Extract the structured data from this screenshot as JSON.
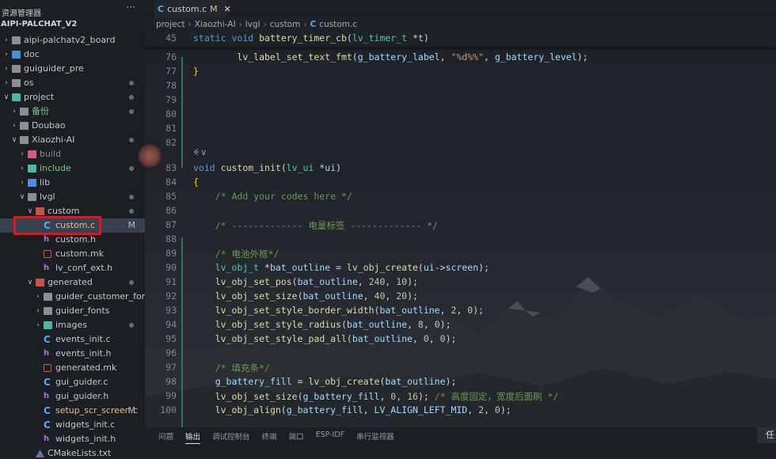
{
  "explorer": {
    "header": "资源管理器",
    "more": "···",
    "project": "AIPI-PALCHAT_V2",
    "items": [
      {
        "label": "aipi-palchatv2_board",
        "level": 0,
        "type": "folder",
        "color": "gray",
        "expanded": false,
        "dot": false
      },
      {
        "label": "doc",
        "level": 0,
        "type": "folder",
        "color": "blue",
        "expanded": false,
        "dot": false
      },
      {
        "label": "guiguider_pre",
        "level": 0,
        "type": "folder",
        "color": "gray",
        "expanded": false,
        "dot": false
      },
      {
        "label": "os",
        "level": 0,
        "type": "folder",
        "color": "gray",
        "expanded": false,
        "dot": true
      },
      {
        "label": "project",
        "level": 0,
        "type": "folder",
        "color": "teal",
        "expanded": true,
        "dot": true
      },
      {
        "label": "备份",
        "level": 1,
        "type": "folder",
        "color": "gray",
        "expanded": false,
        "dot": true,
        "green": true
      },
      {
        "label": "Doubao",
        "level": 1,
        "type": "folder",
        "color": "gray",
        "expanded": false,
        "dot": false
      },
      {
        "label": "Xiaozhi-AI",
        "level": 1,
        "type": "folder",
        "color": "gray",
        "expanded": true,
        "dot": true
      },
      {
        "label": "build",
        "level": 2,
        "type": "folder",
        "color": "pink",
        "expanded": false,
        "dot": false,
        "dim": true
      },
      {
        "label": "include",
        "level": 2,
        "type": "folder",
        "color": "teal",
        "expanded": false,
        "dot": true,
        "green": true
      },
      {
        "label": "lib",
        "level": 2,
        "type": "folder",
        "color": "blue",
        "expanded": false,
        "dot": false
      },
      {
        "label": "lvgl",
        "level": 2,
        "type": "folder",
        "color": "gray",
        "expanded": true,
        "dot": true
      },
      {
        "label": "custom",
        "level": 3,
        "type": "folder",
        "color": "red",
        "expanded": true,
        "dot": true
      },
      {
        "label": "custom.c",
        "level": 4,
        "type": "c",
        "selected": true,
        "mod": "M"
      },
      {
        "label": "custom.h",
        "level": 4,
        "type": "h"
      },
      {
        "label": "custom.mk",
        "level": 4,
        "type": "mk"
      },
      {
        "label": "lv_conf_ext.h",
        "level": 4,
        "type": "h"
      },
      {
        "label": "generated",
        "level": 3,
        "type": "folder",
        "color": "red",
        "expanded": true,
        "dot": true
      },
      {
        "label": "guider_customer_fonts",
        "level": 4,
        "type": "folder",
        "color": "gray",
        "expanded": false
      },
      {
        "label": "guider_fonts",
        "level": 4,
        "type": "folder",
        "color": "gray",
        "expanded": false
      },
      {
        "label": "images",
        "level": 4,
        "type": "folder",
        "color": "teal",
        "expanded": false,
        "dot": true
      },
      {
        "label": "events_init.c",
        "level": 4,
        "type": "c"
      },
      {
        "label": "events_init.h",
        "level": 4,
        "type": "h"
      },
      {
        "label": "generated.mk",
        "level": 4,
        "type": "mk"
      },
      {
        "label": "gui_guider.c",
        "level": 4,
        "type": "c"
      },
      {
        "label": "gui_guider.h",
        "level": 4,
        "type": "h"
      },
      {
        "label": "setup_scr_screen.c",
        "level": 4,
        "type": "c",
        "mod": "M"
      },
      {
        "label": "widgets_init.c",
        "level": 4,
        "type": "c"
      },
      {
        "label": "widgets_init.h",
        "level": 4,
        "type": "h"
      },
      {
        "label": "CMakeLists.txt",
        "level": 3,
        "type": "txt"
      }
    ]
  },
  "tab": {
    "icon": "C",
    "label": "custom.c",
    "status": "M",
    "close": "✕"
  },
  "breadcrumb": [
    "project",
    "Xiaozhi-AI",
    "lvgl",
    "custom",
    "custom.c"
  ],
  "sticky": {
    "line": "45",
    "code": "static void battery_timer_cb(lv_timer_t *t)"
  },
  "codelens": "ꔾ∨",
  "code_lines": [
    {
      "n": "76"
    },
    {
      "n": "77"
    },
    {
      "n": "78"
    },
    {
      "n": "79"
    },
    {
      "n": "80"
    },
    {
      "n": "81"
    },
    {
      "n": "82"
    },
    {
      "n": "83"
    },
    {
      "n": "84"
    },
    {
      "n": "85"
    },
    {
      "n": "86"
    },
    {
      "n": "87"
    },
    {
      "n": "88"
    },
    {
      "n": "89"
    },
    {
      "n": "90"
    },
    {
      "n": "91"
    },
    {
      "n": "92"
    },
    {
      "n": "93"
    },
    {
      "n": "94"
    },
    {
      "n": "95"
    },
    {
      "n": "96"
    },
    {
      "n": "97"
    },
    {
      "n": "98"
    },
    {
      "n": "99"
    },
    {
      "n": "100"
    }
  ],
  "panel": {
    "tabs": [
      "问题",
      "输出",
      "调试控制台",
      "终端",
      "端口",
      "ESP-IDF",
      "串行监视器"
    ],
    "active": "输出",
    "right": "任"
  }
}
